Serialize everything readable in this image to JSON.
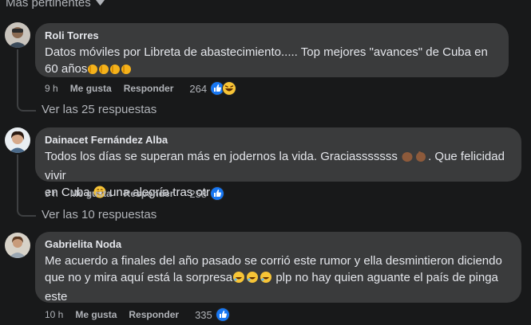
{
  "sort": {
    "label": "Más pertinentes"
  },
  "comments": [
    {
      "author": "Roli Torres",
      "text": "Datos móviles por Libreta de abastecimiento..... Top mejores \"avances\" de Cuba en 60 años",
      "emoji_suffix": [
        "clapping-hands",
        "clapping-hands",
        "clapping-hands",
        "clapping-hands"
      ],
      "time": "9 h",
      "like": "Me gusta",
      "reply": "Responder",
      "reaction_count": "264",
      "reactions": [
        "like",
        "haha"
      ],
      "view_replies": "Ver las 25 respuestas"
    },
    {
      "author": "Dainacet Fernández Alba",
      "text_line1": "Todos los días se superan más en jodernos la vida. Graciasssssss",
      "text_line2a": "en Cuba",
      "text_line2b": "una alegría tras otra",
      "text_line1_end": ". Que felicidad vivir",
      "time": "9 h",
      "like": "Me gusta",
      "reply": "Responder",
      "reaction_count": "258",
      "reactions": [
        "like"
      ],
      "view_replies": "Ver las 10 respuestas"
    },
    {
      "author": "Gabrielita Noda",
      "text_line1": "Me acuerdo a finales del año pasado se corrió este rumor y ella desmintieron diciendo",
      "text_line2a": "que no y mira aquí está la sorpresa",
      "text_line2b": "plp no hay quien aguante el país de pinga",
      "text_line3": "este",
      "time": "10 h",
      "like": "Me gusta",
      "reply": "Responder",
      "reaction_count": "335",
      "reactions": [
        "like"
      ]
    }
  ],
  "colors": {
    "background": "#18191a",
    "bubble": "#3a3b3c",
    "like_blue": "#1877f2",
    "muted": "#b0b3b8"
  }
}
